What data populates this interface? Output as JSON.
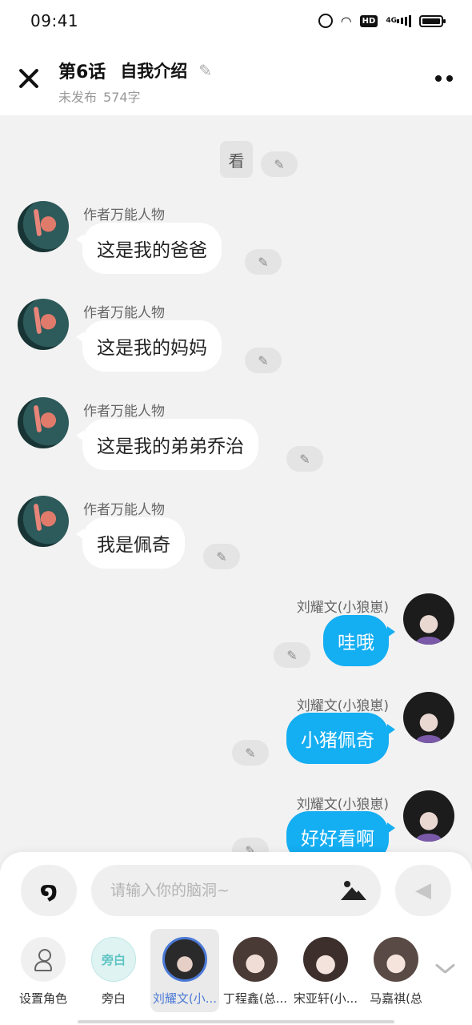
{
  "status_bar": {
    "time": "09:41",
    "icons": [
      "alarm-icon",
      "wifi-icon",
      "hd-icon",
      "4g-signal-icon",
      "battery-icon"
    ],
    "network": "4G"
  },
  "header": {
    "chapter": "第6话",
    "title": "自我介绍",
    "status": "未发布",
    "word_count": "574字"
  },
  "messages": [
    {
      "type": "narration",
      "text": "看"
    },
    {
      "side": "left",
      "sender": "作者万能人物",
      "text": "这是我的爸爸"
    },
    {
      "side": "left",
      "sender": "作者万能人物",
      "text": "这是我的妈妈"
    },
    {
      "side": "left",
      "sender": "作者万能人物",
      "text": "这是我的弟弟乔治"
    },
    {
      "side": "left",
      "sender": "作者万能人物",
      "text": "我是佩奇"
    },
    {
      "side": "right",
      "sender": "刘耀文(小狼崽)",
      "text": "哇哦"
    },
    {
      "side": "right",
      "sender": "刘耀文(小狼崽)",
      "text": "小猪佩奇"
    },
    {
      "side": "right",
      "sender": "刘耀文(小狼崽)",
      "text": "好好看啊"
    }
  ],
  "input": {
    "placeholder": "请输入你的脑洞~"
  },
  "characters": [
    {
      "label": "设置角色"
    },
    {
      "label": "旁白",
      "avatar_text": "旁白"
    },
    {
      "label": "刘耀文(小...",
      "selected": true
    },
    {
      "label": "丁程鑫(总..."
    },
    {
      "label": "宋亚轩(小..."
    },
    {
      "label": "马嘉祺(总"
    }
  ],
  "colors": {
    "bubble_right": "#14aef2",
    "selected_accent": "#4b79d6",
    "background": "#f2f2f2"
  }
}
